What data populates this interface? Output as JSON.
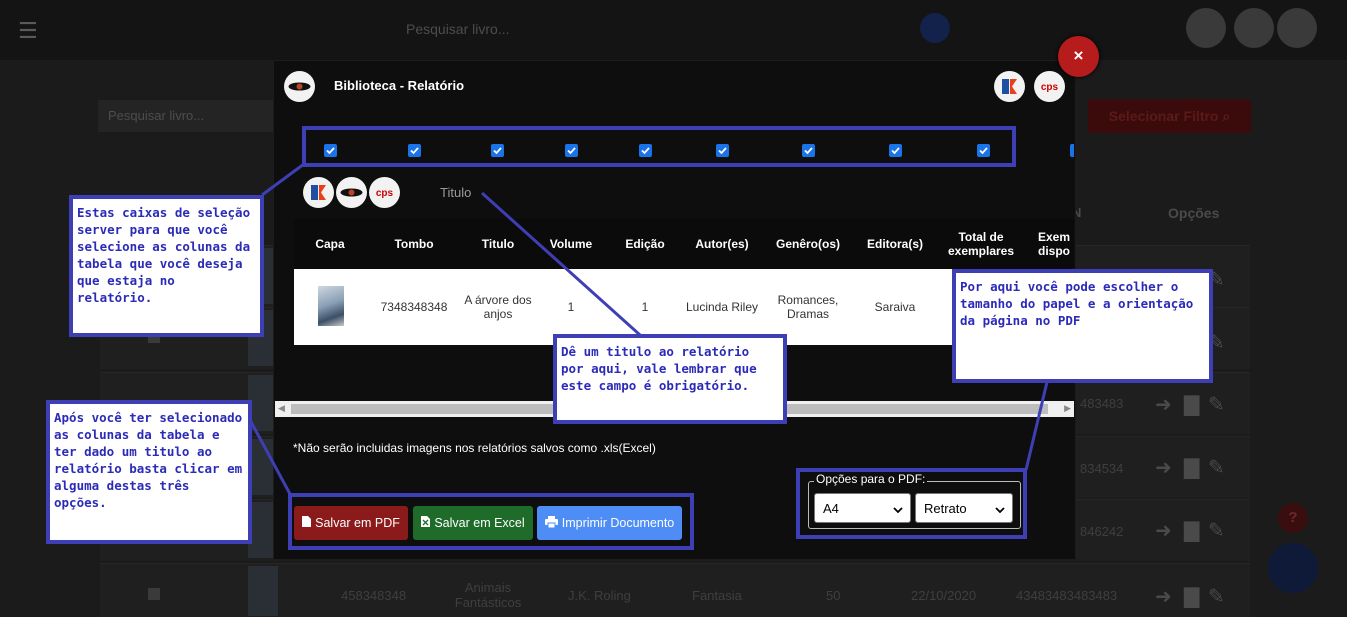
{
  "background": {
    "top_search_placeholder": "Pesquisar livro...",
    "search_placeholder": "Pesquisar livro...",
    "filter_button": "Selecionar Filtro",
    "col_n": "N",
    "col_options": "Opções",
    "rows": [
      {
        "tombo": "",
        "titulo": "",
        "autor": "",
        "genero": "",
        "vol": "",
        "data": "",
        "isbn": "483483"
      },
      {
        "tombo": "",
        "titulo": "",
        "autor": "",
        "genero": "",
        "vol": "",
        "data": "",
        "isbn": "834534"
      },
      {
        "tombo": "",
        "titulo": "",
        "autor": "",
        "genero": "",
        "vol": "",
        "data": "",
        "isbn": "846242"
      },
      {
        "tombo": "458348348",
        "titulo": "Animais Fantásticos",
        "autor": "J.K. Roling",
        "genero": "Fantasia",
        "vol": "50",
        "data": "22/10/2020",
        "isbn": "43483483483483"
      }
    ],
    "help_label": "?"
  },
  "modal": {
    "title": "Biblioteca - Relatório",
    "close_label": "×",
    "title_input_placeholder": "Titulo",
    "checkbox_count": 10,
    "columns": [
      "Capa",
      "Tombo",
      "Titulo",
      "Volume",
      "Edição",
      "Autor(es)",
      "Genêro(os)",
      "Editora(s)",
      "Total de exemplares",
      "Exem dispo"
    ],
    "row": {
      "tombo": "7348348348",
      "titulo": "A árvore dos anjos",
      "volume": "1",
      "edicao": "1",
      "autor": "Lucinda Riley",
      "genero": "Romances, Dramas",
      "editora": "Saraiva"
    },
    "note": "*Não serão incluidas imagens nos relatórios salvos como .xls(Excel)",
    "buttons": {
      "pdf": "Salvar em PDF",
      "excel": "Salvar em Excel",
      "print": "Imprimir Documento"
    },
    "pdf_options": {
      "legend": "Opções para o PDF:",
      "paper": "A4",
      "orientation": "Retrato"
    }
  },
  "annotations": {
    "checkboxes": "Estas caixas de seleção server para que você selecione as colunas da tabela que você deseja que estaja no relatório.",
    "title": "Dê um titulo ao relatório por aqui, vale lembrar que este campo é obrigatório.",
    "pdf": "Por aqui você pode escolher o tamanho do papel e a orientação da página no PDF",
    "buttons": "Após você ter selecionado as colunas da tabela e ter dado um titulo ao relatório basta clicar em alguma destas três opções."
  },
  "colors": {
    "pdf_button": "#8b1a1a",
    "excel_button": "#1e6b2a",
    "print_button": "#4d8df5",
    "annotation": "#3f3fb5",
    "close_button": "#b71c1c"
  }
}
